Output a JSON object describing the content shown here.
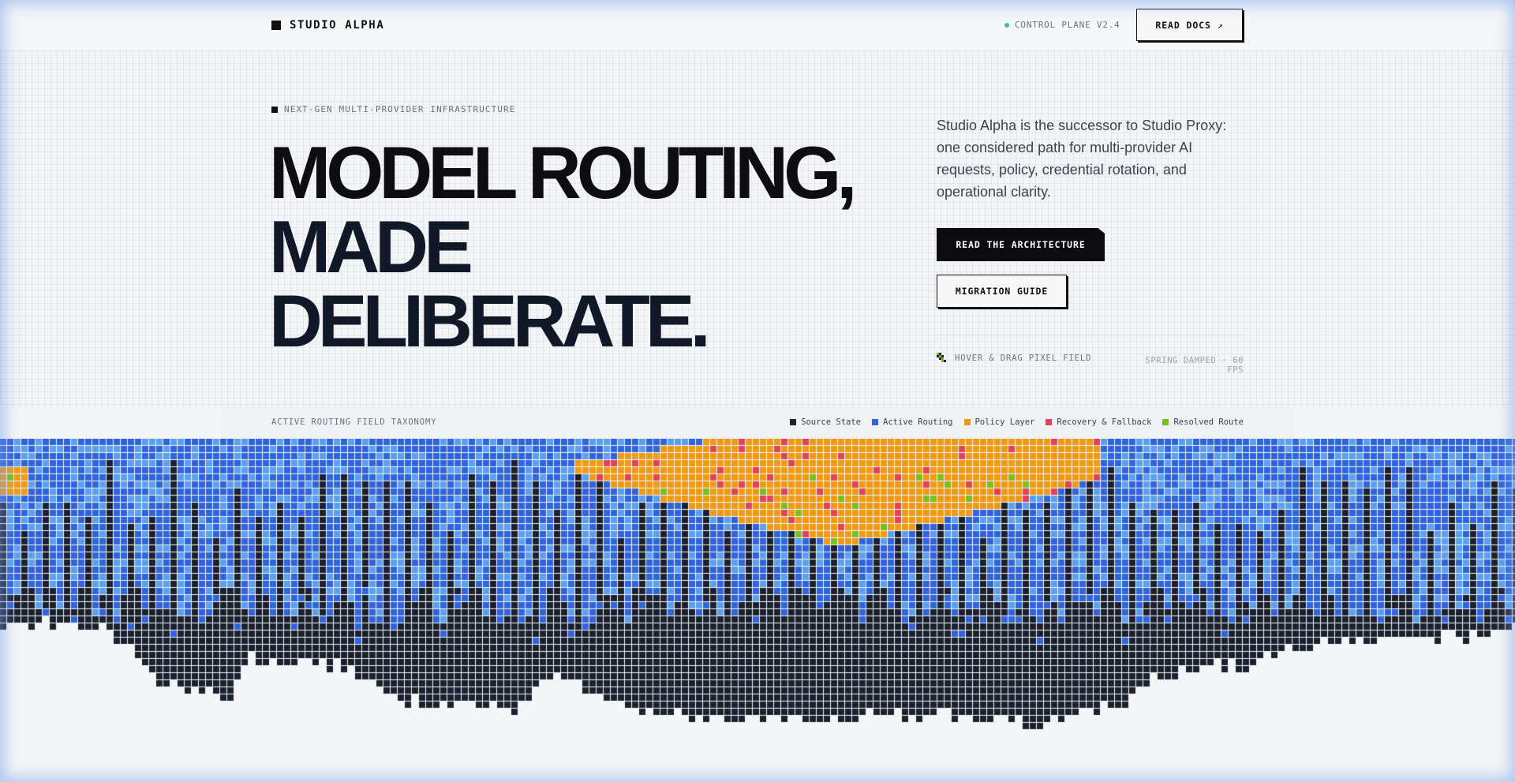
{
  "header": {
    "brand": "STUDIO ALPHA",
    "status": "CONTROL PLANE V2.4",
    "docs_label": "READ DOCS",
    "docs_arrow": "↗"
  },
  "hero": {
    "eyebrow": "NEXT-GEN MULTI-PROVIDER INFRASTRUCTURE",
    "headline": [
      "MODEL ROUTING,",
      "MADE",
      "DELIBERATE."
    ],
    "lede": "Studio Alpha is the successor to Studio Proxy: one considered path for multi-provider AI requests, policy, credential rotation, and operational clarity.",
    "primary_cta": "READ THE ARCHITECTURE",
    "secondary_cta": "MIGRATION GUIDE",
    "hint": "HOVER & DRAG PIXEL FIELD",
    "meta": "SPRING DAMPED · 60 FPS"
  },
  "taxonomy": {
    "title": "ACTIVE ROUTING FIELD TAXONOMY",
    "legend": [
      {
        "label": "Source State",
        "color": "#1c2130",
        "icon": "source-state-swatch"
      },
      {
        "label": "Active Routing",
        "color": "#2f64dd",
        "icon": "active-routing-swatch"
      },
      {
        "label": "Policy Layer",
        "color": "#ef9a16",
        "icon": "policy-layer-swatch"
      },
      {
        "label": "Recovery & Fallback",
        "color": "#e2425a",
        "icon": "recovery-fallback-swatch"
      },
      {
        "label": "Resolved Route",
        "color": "#78be24",
        "icon": "resolved-route-swatch"
      }
    ]
  },
  "colors": {
    "ink": "#0e0e12",
    "status_dot": "#3cc48a",
    "active_routing_light": "#5aa0ef",
    "background": "#f4f5f6"
  }
}
